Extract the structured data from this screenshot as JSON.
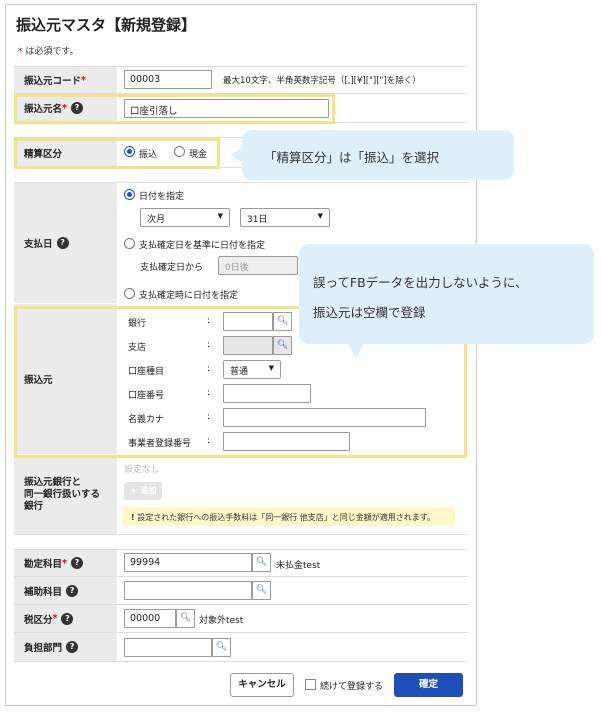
{
  "header": {
    "title": "振込元マスタ【新規登録】",
    "required_note_mark": "*",
    "required_note": "は必須です。"
  },
  "fields": {
    "code": {
      "label": "振込元コード",
      "required": "*",
      "value": "00003",
      "hint": "最大10文字、半角英数字記号（[,][¥][\"][\"]を除く）"
    },
    "name": {
      "label": "振込元名",
      "required": "*",
      "value": "口座引落し"
    },
    "settlement": {
      "label": "精算区分",
      "options": [
        "振込",
        "現金"
      ],
      "selected": "振込"
    },
    "payment_date": {
      "label": "支払日",
      "opt1": "日付を指定",
      "month_value": "次月",
      "day_value": "31日",
      "opt2": "支払確定日を基準に日付を指定",
      "from_label": "支払確定日から",
      "after_value": "0日後",
      "opt3": "支払確定時に日付を指定"
    },
    "source": {
      "label": "振込元",
      "bank_label": "銀行",
      "branch_label": "支店",
      "type_label": "口座種目",
      "type_value": "普通",
      "number_label": "口座番号",
      "holder_label": "名義カナ",
      "reg_label": "事業者登録番号",
      "colon": ":"
    },
    "same_bank": {
      "label_line1": "振込元銀行と",
      "label_line2": "同一銀行扱いする",
      "label_line3": "銀行",
      "empty": "設定なし",
      "add_button": "＋ 追加",
      "note": "設定された銀行への振込手数料は「同一銀行 他支店」と同じ金額が適用されます。"
    },
    "account": {
      "label": "勘定科目",
      "required": "*",
      "value": "99994",
      "name": "未払金test"
    },
    "sub_account": {
      "label": "補助科目"
    },
    "tax": {
      "label": "税区分",
      "required": "*",
      "value": "00000",
      "name": "対象外test"
    },
    "department": {
      "label": "負担部門"
    }
  },
  "footer": {
    "cancel": "キャンセル",
    "continue_label": "続けて登録する",
    "confirm": "確定"
  },
  "callouts": {
    "settlement": "「精算区分」は「振込」を選択",
    "source_line1": "誤ってFBデータを出力しないように、",
    "source_line2": "振込元は空欄で登録"
  },
  "colors": {
    "highlight": "#f3e48a",
    "bubble": "#deeffc",
    "primary": "#1e4fb8",
    "required": "#d0021b"
  },
  "icons": {
    "help": "question-circle",
    "search": "magnifier",
    "dropdown": "caret-down"
  }
}
